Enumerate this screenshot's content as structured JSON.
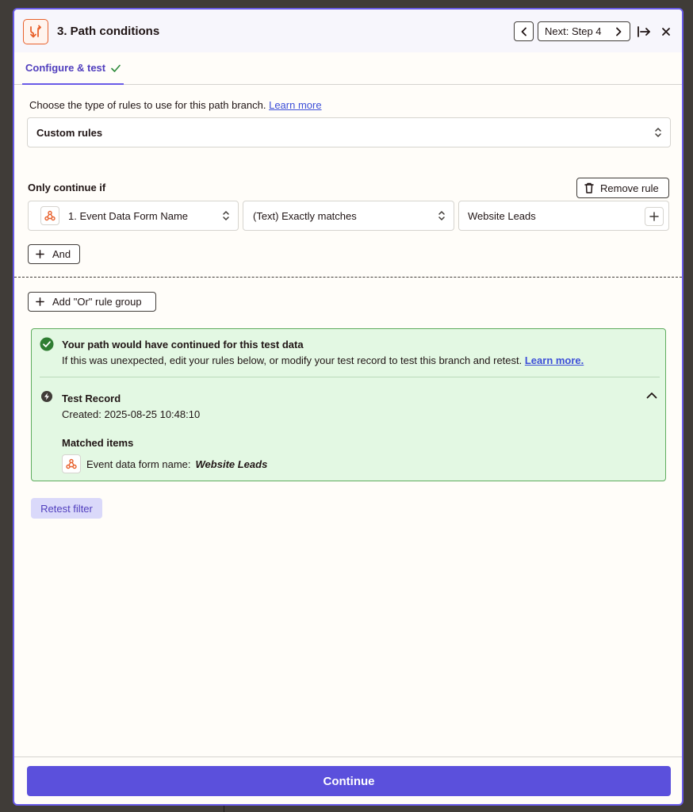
{
  "header": {
    "step_title": "3. Path conditions",
    "next_label": "Next: Step 4"
  },
  "tabs": [
    {
      "label": "Configure & test",
      "completed": true
    }
  ],
  "rules": {
    "intro_text": "Choose the type of rules to use for this path branch.",
    "learn_more_label": "Learn more",
    "rule_type": "Custom rules",
    "only_continue_label": "Only continue if",
    "remove_rule_label": "Remove rule",
    "condition": {
      "field": "1. Event Data Form Name",
      "operator": "(Text) Exactly matches",
      "value": "Website Leads"
    },
    "and_label": "And",
    "or_group_label": "Add \"Or\" rule group"
  },
  "result": {
    "title": "Your path would have continued for this test data",
    "message": "If this was unexpected, edit your rules below, or modify your test record to test this branch and retest.",
    "learn_more_label": "Learn more.",
    "record_title": "Test Record",
    "created": "Created: 2025-08-25 10:48:10",
    "matched_label": "Matched items",
    "matched_item_label": "Event data form name:",
    "matched_item_value": "Website Leads"
  },
  "retest_label": "Retest filter",
  "continue_label": "Continue",
  "colors": {
    "accent": "#695be8",
    "primary_button": "#5b50dc",
    "success_bg": "#e3f8e3",
    "success_border": "#5eac5e",
    "app_icon": "#e8612c"
  },
  "icons": [
    "path-icon",
    "chevron-left-icon",
    "chevron-right-icon",
    "arrow-to-right-icon",
    "close-icon",
    "check-icon",
    "chevron-up-down-icon",
    "trash-icon",
    "webhook-icon",
    "plus-icon",
    "check-circle-icon",
    "bolt-icon",
    "chevron-up-icon"
  ]
}
